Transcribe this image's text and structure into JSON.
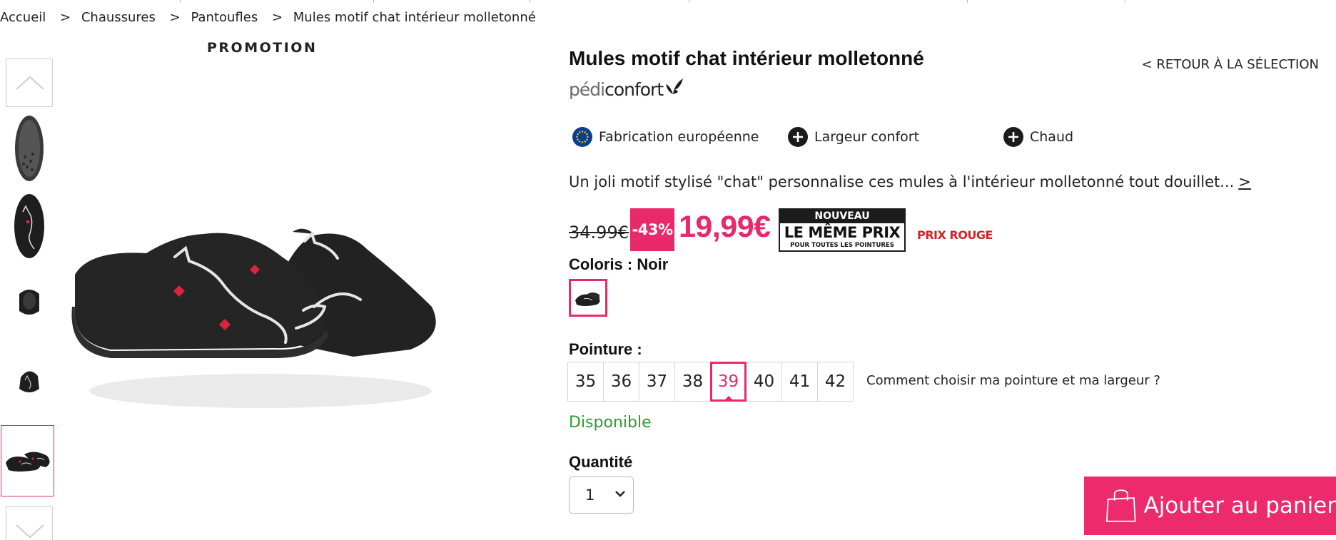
{
  "breadcrumb": {
    "items": [
      "Accueil",
      "Chaussures",
      "Pantoufles",
      "Mules motif chat intérieur molletonné"
    ],
    "separator": ">"
  },
  "gallery": {
    "promo_label": "PROMOTION",
    "thumbnail_count": 5,
    "active_thumbnail": 5
  },
  "product": {
    "title": "Mules motif chat intérieur molletonné",
    "back_link": "< RETOUR À LA SÉLECTION",
    "brand_light": "pédi",
    "brand_bold": "confort",
    "features": [
      {
        "icon": "eu-flag-icon",
        "label": "Fabrication européenne"
      },
      {
        "icon": "plus-icon",
        "label": "Largeur confort"
      },
      {
        "icon": "plus-icon",
        "label": "Chaud"
      }
    ],
    "description": "Un joli motif stylisé \"chat\" personnalise ces mules à l'intérieur molletonné tout douillet...",
    "description_more": ">"
  },
  "pricing": {
    "old_price": "34.99€",
    "discount": "-43%",
    "new_price": "19,99€",
    "badge_top": "NOUVEAU",
    "badge_main": "LE MÊME PRIX",
    "badge_bottom": "POUR TOUTES LES POINTURES",
    "prix_rouge": "PRIX ROUGE"
  },
  "color": {
    "label": "Coloris : Noir",
    "selected": "Noir"
  },
  "size": {
    "label": "Pointure :",
    "options": [
      "35",
      "36",
      "37",
      "38",
      "39",
      "40",
      "41",
      "42"
    ],
    "selected": "39",
    "help_link": "Comment choisir ma pointure et ma largeur ?"
  },
  "availability": "Disponible",
  "quantity": {
    "label": "Quantité",
    "value": "1"
  },
  "cart": {
    "button_label": "Ajouter au panier"
  },
  "colors": {
    "accent": "#e8296a",
    "available": "#2c9e2c",
    "prix_rouge": "#d81f26"
  }
}
